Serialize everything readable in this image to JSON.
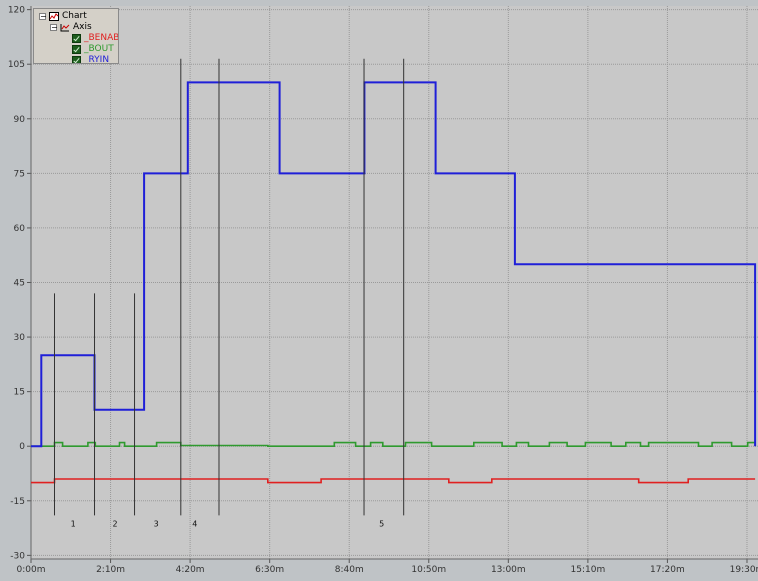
{
  "legend": {
    "root_label": "Chart",
    "axis_label": "Axis",
    "items": [
      {
        "label": "_BENABL",
        "color": "#e02020"
      },
      {
        "label": "_BOUT",
        "color": "#2f9a2f"
      },
      {
        "label": "_RYIN",
        "color": "#1f1fd8"
      }
    ]
  },
  "chart_data": {
    "type": "line",
    "step": true,
    "grid": true,
    "ylim": [
      -31,
      121
    ],
    "xlim_min": [
      0,
      19.8
    ],
    "y_ticks": [
      -30,
      -15,
      0,
      15,
      30,
      45,
      60,
      75,
      90,
      105,
      120
    ],
    "y_tick_labels": [
      "-30",
      "-15",
      "0",
      "15",
      "30",
      "45",
      "60",
      "75",
      "90",
      "105",
      "120"
    ],
    "x_ticks_min": [
      0,
      2.167,
      4.333,
      6.5,
      8.667,
      10.833,
      13.0,
      15.167,
      17.333,
      19.5
    ],
    "x_tick_labels": [
      "0:00m",
      "2:10m",
      "4:20m",
      "6:30m",
      "8:40m",
      "10:50m",
      "13:00m",
      "15:10m",
      "17:20m",
      "19:30m"
    ],
    "series": [
      {
        "name": "_RYIN",
        "color": "#1f1fd8",
        "x_min": [
          0,
          0.28,
          0.28,
          1.73,
          1.73,
          3.08,
          3.08,
          4.27,
          4.27,
          6.77,
          6.77,
          9.08,
          9.08,
          11.02,
          11.02,
          13.18,
          13.18,
          19.72,
          19.72
        ],
        "y": [
          0,
          0,
          25,
          25,
          10,
          10,
          75,
          75,
          100,
          100,
          75,
          75,
          100,
          100,
          75,
          75,
          50,
          50,
          0
        ]
      },
      {
        "name": "_BOUT",
        "color": "#2f9a2f",
        "x_min": [
          0,
          0.64,
          0.64,
          0.86,
          0.86,
          1.55,
          1.55,
          1.75,
          1.75,
          2.41,
          2.41,
          2.55,
          2.55,
          3.42,
          3.42,
          4.08,
          4.08,
          6.45,
          6.45,
          8.26,
          8.26,
          8.84,
          8.84,
          9.25,
          9.25,
          9.58,
          9.58,
          10.2,
          10.2,
          10.91,
          10.91,
          12.06,
          12.06,
          12.83,
          12.83,
          13.22,
          13.22,
          13.55,
          13.55,
          14.12,
          14.12,
          14.6,
          14.6,
          15.1,
          15.1,
          15.8,
          15.8,
          16.2,
          16.2,
          16.6,
          16.6,
          16.82,
          16.82,
          18.18,
          18.18,
          18.55,
          18.55,
          19.08,
          19.08,
          19.52,
          19.52,
          19.72
        ],
        "y": [
          0,
          0,
          1,
          1,
          0,
          0,
          1,
          1,
          0,
          0,
          1,
          1,
          0,
          0,
          1,
          1,
          0.2,
          0.2,
          0,
          0,
          1,
          1,
          0,
          0,
          1,
          1,
          0,
          0,
          1,
          1,
          0,
          0,
          1,
          1,
          0,
          0,
          1,
          1,
          0,
          0,
          1,
          1,
          0,
          0,
          1,
          1,
          0,
          0,
          1,
          1,
          0,
          0,
          1,
          1,
          0,
          0,
          1,
          1,
          0,
          0,
          1,
          1
        ]
      },
      {
        "name": "_BENABL",
        "color": "#e02020",
        "x_min": [
          0,
          0.64,
          0.64,
          6.45,
          6.45,
          7.9,
          7.9,
          11.38,
          11.38,
          12.55,
          12.55,
          16.55,
          16.55,
          17.9,
          17.9,
          19.72
        ],
        "y": [
          -10,
          -10,
          -9,
          -9,
          -10,
          -10,
          -9,
          -9,
          -10,
          -10,
          -9,
          -9,
          -10,
          -10,
          -9,
          -9
        ]
      }
    ],
    "markers": [
      {
        "x_min": 0.64,
        "group_label": "1"
      },
      {
        "x_min": 1.73,
        "group_label": "2"
      },
      {
        "x_min": 2.82,
        "group_label": "3"
      },
      {
        "x_min": 4.08,
        "group_label": "4"
      },
      {
        "x_min": 5.12,
        "group_label": ""
      },
      {
        "x_min": 9.07,
        "group_label": "5"
      },
      {
        "x_min": 10.15,
        "group_label": ""
      }
    ],
    "marker_label_x_min": [
      1.15,
      2.29,
      3.41,
      4.46,
      9.55
    ]
  }
}
